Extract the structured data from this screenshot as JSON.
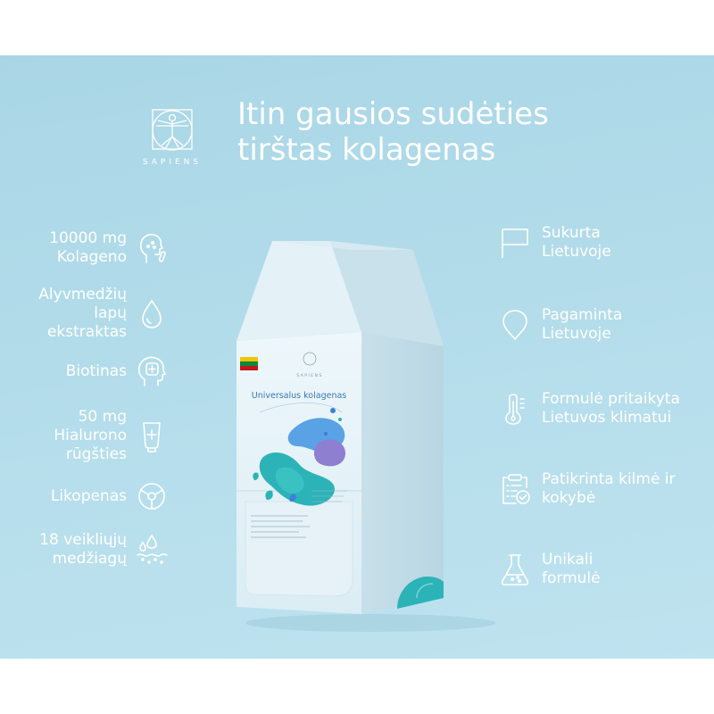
{
  "brand": {
    "name": "SAPIENS"
  },
  "headline": {
    "line1": "Itin gausios sudėties",
    "line2": "tirštas kolagenas"
  },
  "left_features": [
    {
      "lines": [
        "10000 mg",
        "Kolageno"
      ],
      "icon": "face-profile-icon"
    },
    {
      "lines": [
        "Alyvmedžių",
        "lapų",
        "ekstraktas"
      ],
      "icon": "drop-icon"
    },
    {
      "lines": [
        "Biotinas"
      ],
      "icon": "head-plus-icon"
    },
    {
      "lines": [
        "50 mg",
        "Hialurono",
        "rūgšties"
      ],
      "icon": "tube-plus-icon"
    },
    {
      "lines": [
        "Likopenas"
      ],
      "icon": "circle-segments-icon"
    },
    {
      "lines": [
        "18 veikliųjų",
        "medžiagų"
      ],
      "icon": "skin-drops-icon"
    }
  ],
  "right_features": [
    {
      "lines": [
        "Sukurta",
        "Lietuvoje"
      ],
      "icon": "flag-icon"
    },
    {
      "lines": [
        "Pagaminta",
        "Lietuvoje"
      ],
      "icon": "location-pin-icon"
    },
    {
      "lines": [
        "Formulė pritaikyta",
        "Lietuvos klimatui"
      ],
      "icon": "thermometer-icon"
    },
    {
      "lines": [
        "Patikrinta kilmė ir",
        "kokybė"
      ],
      "icon": "clipboard-check-icon"
    },
    {
      "lines": [
        "Unikali",
        "formulė"
      ],
      "icon": "flask-icon"
    }
  ],
  "product": {
    "brand": "SAPIENS",
    "name": "Universalus kolagenas"
  },
  "colors": {
    "background": "#b3dcea",
    "text": "#ffffff",
    "accent_teal": "#2bb3b8",
    "accent_blue": "#3f7fd9",
    "accent_purple": "#8e7fd0"
  }
}
